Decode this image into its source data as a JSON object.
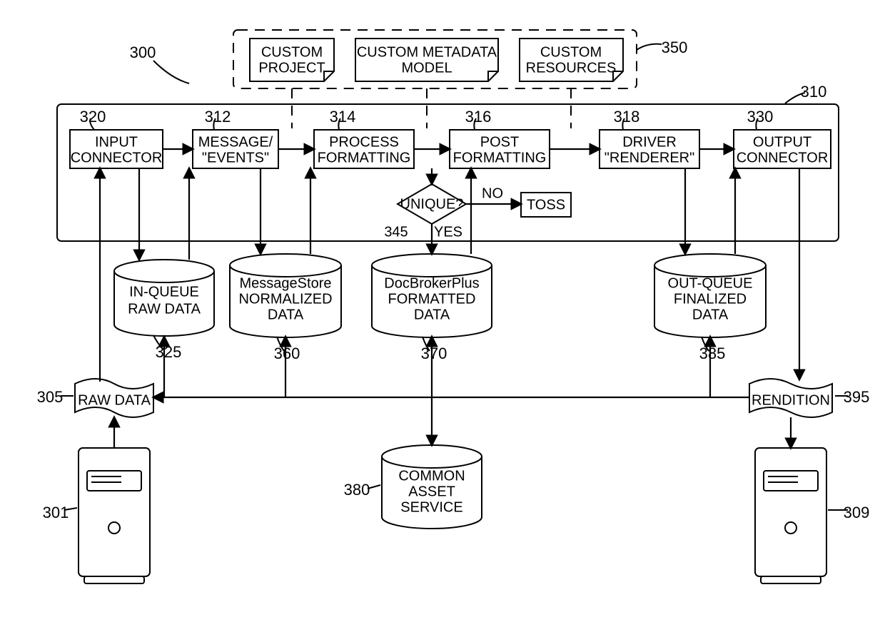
{
  "ref_main": "300",
  "ref_dashed": "350",
  "ref_pipeline": "310",
  "dashed": {
    "doc1": [
      "CUSTOM",
      "PROJECT"
    ],
    "doc2": [
      "CUSTOM METADATA",
      "MODEL"
    ],
    "doc3": [
      "CUSTOM",
      "RESOURCES"
    ]
  },
  "boxes": {
    "b320": {
      "ref": "320",
      "lines": [
        "INPUT",
        "CONNECTOR"
      ]
    },
    "b312": {
      "ref": "312",
      "lines": [
        "MESSAGE/",
        "\"EVENTS\""
      ]
    },
    "b314": {
      "ref": "314",
      "lines": [
        "PROCESS",
        "FORMATTING"
      ]
    },
    "b316": {
      "ref": "316",
      "lines": [
        "POST",
        "FORMATTING"
      ]
    },
    "b318": {
      "ref": "318",
      "lines": [
        "DRIVER",
        "\"RENDERER\""
      ]
    },
    "b330": {
      "ref": "330",
      "lines": [
        "OUTPUT",
        "CONNECTOR"
      ]
    }
  },
  "decision": {
    "ref": "345",
    "q": "UNIQUE?",
    "yes": "YES",
    "no": "NO",
    "toss": "TOSS"
  },
  "cyls": {
    "c325": {
      "ref": "325",
      "lines": [
        "IN-QUEUE",
        "RAW DATA"
      ]
    },
    "c360": {
      "ref": "360",
      "lines": [
        "MessageStore",
        "NORMALIZED",
        "DATA"
      ]
    },
    "c370": {
      "ref": "370",
      "lines": [
        "DocBrokerPlus",
        "FORMATTED",
        "DATA"
      ]
    },
    "c385": {
      "ref": "385",
      "lines": [
        "OUT-QUEUE",
        "FINALIZED",
        "DATA"
      ]
    },
    "c380": {
      "ref": "380",
      "lines": [
        "COMMON",
        "ASSET",
        "SERVICE"
      ]
    }
  },
  "docs": {
    "raw": {
      "ref": "305",
      "text": "RAW DATA"
    },
    "rendition": {
      "ref": "395",
      "text": "RENDITION"
    }
  },
  "servers": {
    "left_ref": "301",
    "right_ref": "309"
  }
}
